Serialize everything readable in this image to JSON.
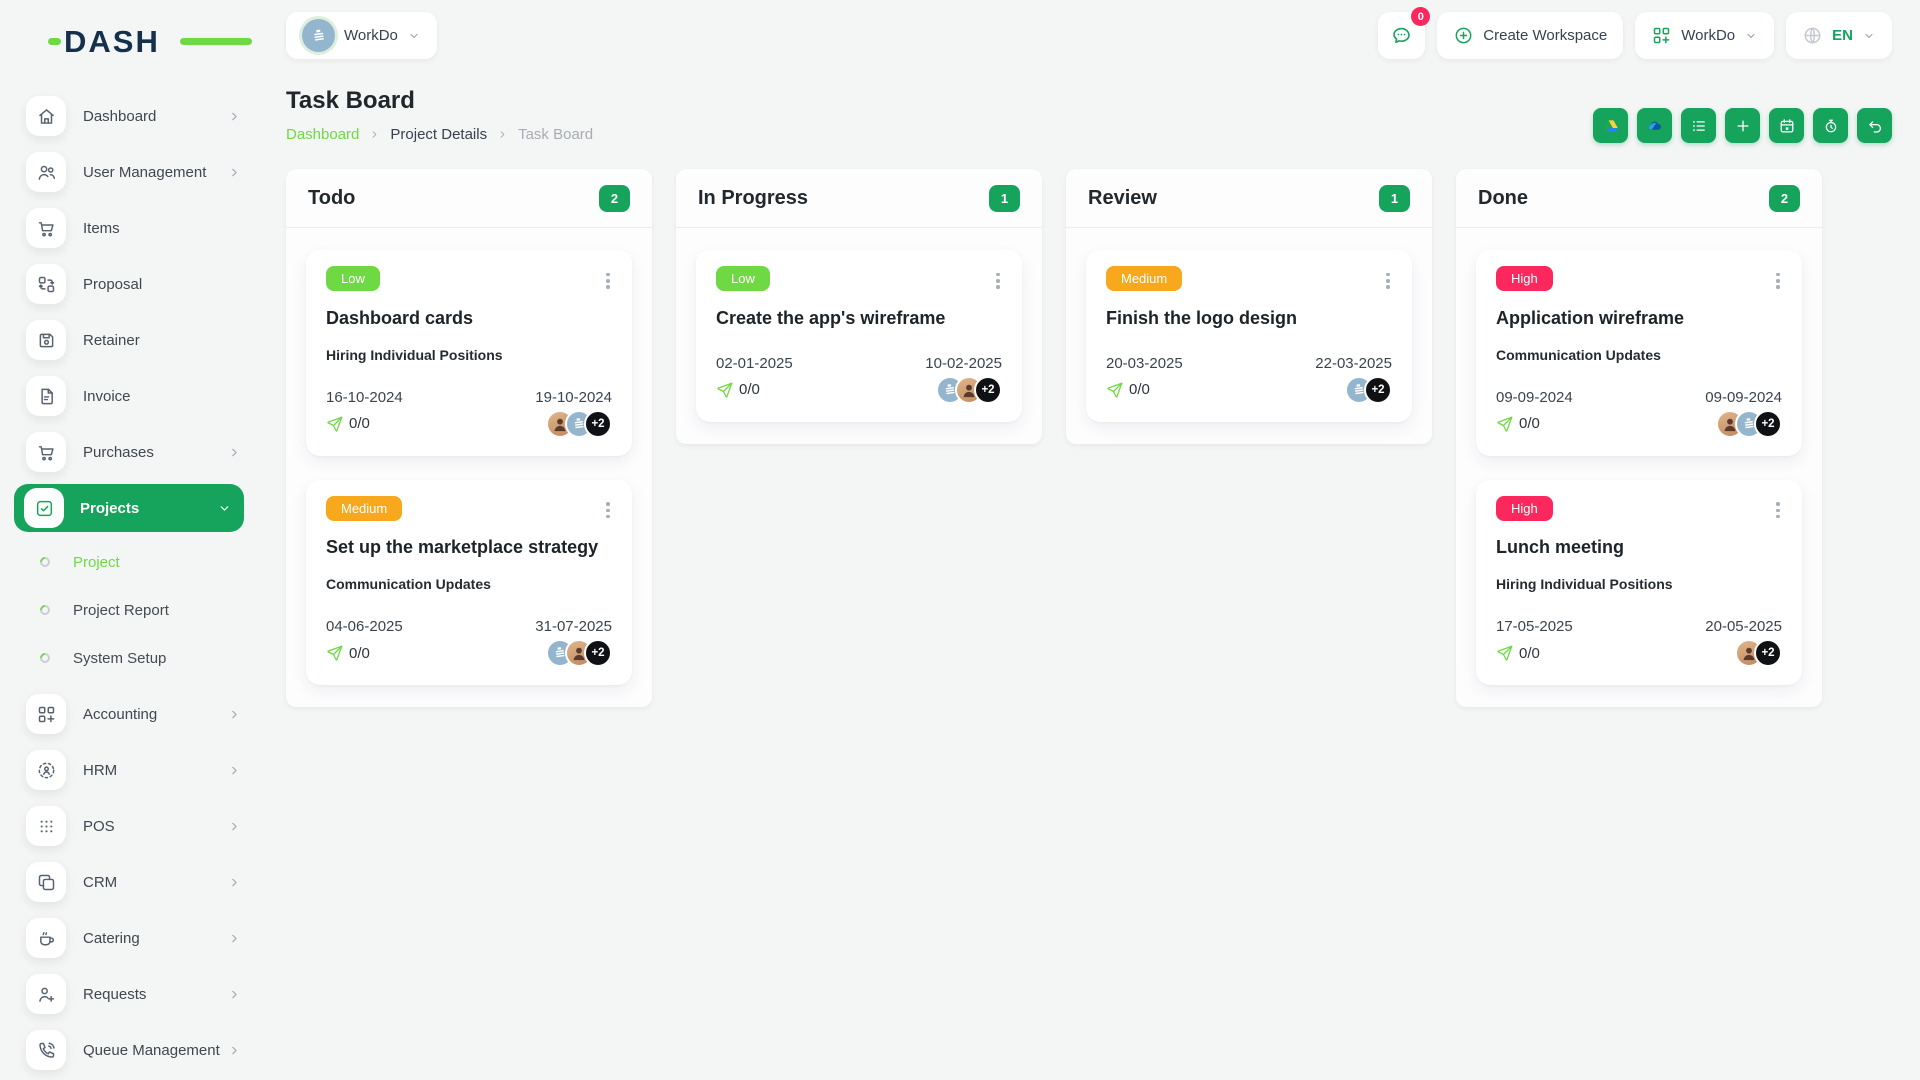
{
  "colors": {
    "emerald": "#16A35C",
    "lime": "#6FD943",
    "orange": "#F8A81D",
    "pink": "#FC275D",
    "navy": "#15304C",
    "page_bg": "#F4F5F5"
  },
  "brand": {
    "name": "DASH"
  },
  "header": {
    "workspace_switcher": {
      "label": "WorkDo",
      "avatar_icon": "building"
    },
    "messages": {
      "icon": "chat-bubble",
      "badge": "0"
    },
    "create_workspace": {
      "label": "Create Workspace",
      "icon": "circle-plus"
    },
    "workspace_menu": {
      "label": "WorkDo",
      "icon": "grid-plus"
    },
    "language": {
      "label": "EN",
      "icon": "globe"
    }
  },
  "sidebar": {
    "items": [
      {
        "label": "Dashboard",
        "icon": "home",
        "chevron": true
      },
      {
        "label": "User Management",
        "icon": "users",
        "chevron": true
      },
      {
        "label": "Items",
        "icon": "cart",
        "chevron": false
      },
      {
        "label": "Proposal",
        "icon": "transfer",
        "chevron": false
      },
      {
        "label": "Retainer",
        "icon": "save",
        "chevron": false
      },
      {
        "label": "Invoice",
        "icon": "file-text",
        "chevron": false
      },
      {
        "label": "Purchases",
        "icon": "cart",
        "chevron": true
      },
      {
        "label": "Projects",
        "icon": "check-square",
        "chevron": true,
        "active": true,
        "children": [
          {
            "label": "Project",
            "active": true
          },
          {
            "label": "Project Report",
            "active": false
          },
          {
            "label": "System Setup",
            "active": false
          }
        ]
      },
      {
        "label": "Accounting",
        "icon": "grid-plus",
        "chevron": true
      },
      {
        "label": "HRM",
        "icon": "user-scan",
        "chevron": true
      },
      {
        "label": "POS",
        "icon": "dots-grid",
        "chevron": true
      },
      {
        "label": "CRM",
        "icon": "copy",
        "chevron": true
      },
      {
        "label": "Catering",
        "icon": "coffee",
        "chevron": true
      },
      {
        "label": "Requests",
        "icon": "user-plus",
        "chevron": true
      },
      {
        "label": "Queue Management",
        "icon": "phone-call",
        "chevron": true
      }
    ]
  },
  "page": {
    "title": "Task Board",
    "breadcrumb": [
      {
        "label": "Dashboard",
        "style": "link"
      },
      {
        "label": "Project Details",
        "style": "dark"
      },
      {
        "label": "Task Board",
        "style": "muted"
      }
    ],
    "toolbar": [
      {
        "icon": "google-drive"
      },
      {
        "icon": "onedrive"
      },
      {
        "icon": "list"
      },
      {
        "icon": "plus"
      },
      {
        "icon": "calendar"
      },
      {
        "icon": "stopwatch"
      },
      {
        "icon": "undo"
      }
    ]
  },
  "board": {
    "columns": [
      {
        "title": "Todo",
        "count": "2",
        "cards": [
          {
            "priority": "Low",
            "level": "low",
            "title": "Dashboard cards",
            "milestone": "Hiring Individual Positions",
            "start_date": "16-10-2024",
            "end_date": "19-10-2024",
            "progress": "0/0",
            "avatars": [
              "person",
              "building"
            ],
            "extra_assignees": "+2"
          },
          {
            "priority": "Medium",
            "level": "medium",
            "title": "Set up the marketplace strategy",
            "milestone": "Communication Updates",
            "start_date": "04-06-2025",
            "end_date": "31-07-2025",
            "progress": "0/0",
            "avatars": [
              "building",
              "person"
            ],
            "extra_assignees": "+2"
          }
        ]
      },
      {
        "title": "In Progress",
        "count": "1",
        "cards": [
          {
            "priority": "Low",
            "level": "low",
            "title": "Create the app's wireframe",
            "milestone": "",
            "start_date": "02-01-2025",
            "end_date": "10-02-2025",
            "progress": "0/0",
            "avatars": [
              "building",
              "person"
            ],
            "extra_assignees": "+2"
          }
        ]
      },
      {
        "title": "Review",
        "count": "1",
        "cards": [
          {
            "priority": "Medium",
            "level": "medium",
            "title": "Finish the logo design",
            "milestone": "",
            "start_date": "20-03-2025",
            "end_date": "22-03-2025",
            "progress": "0/0",
            "avatars": [
              "building"
            ],
            "extra_assignees": "+2"
          }
        ]
      },
      {
        "title": "Done",
        "count": "2",
        "cards": [
          {
            "priority": "High",
            "level": "high",
            "title": "Application wireframe",
            "milestone": "Communication Updates",
            "start_date": "09-09-2024",
            "end_date": "09-09-2024",
            "progress": "0/0",
            "avatars": [
              "person",
              "building"
            ],
            "extra_assignees": "+2"
          },
          {
            "priority": "High",
            "level": "high",
            "title": "Lunch meeting",
            "milestone": "Hiring Individual Positions",
            "start_date": "17-05-2025",
            "end_date": "20-05-2025",
            "progress": "0/0",
            "avatars": [
              "person"
            ],
            "extra_assignees": "+2"
          }
        ]
      }
    ]
  }
}
